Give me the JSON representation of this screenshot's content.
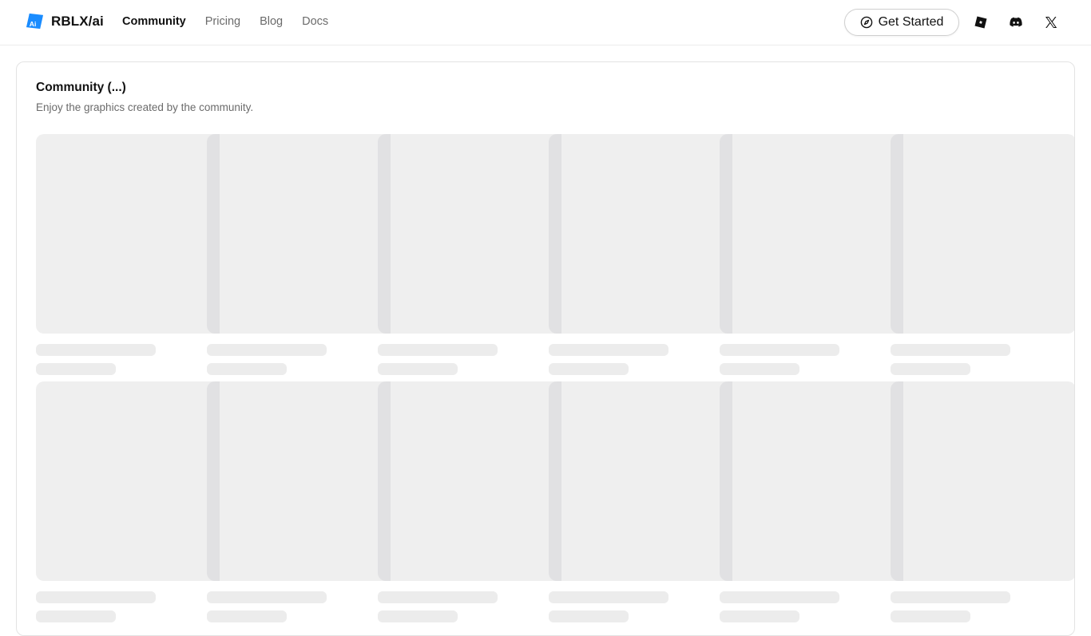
{
  "header": {
    "brand": "RBLX/ai",
    "nav": [
      {
        "label": "Community",
        "active": true
      },
      {
        "label": "Pricing",
        "active": false
      },
      {
        "label": "Blog",
        "active": false
      },
      {
        "label": "Docs",
        "active": false
      }
    ],
    "cta_label": "Get Started",
    "social_icons": [
      "roblox-icon",
      "discord-icon",
      "x-icon"
    ]
  },
  "community": {
    "title": "Community (...)",
    "subtitle": "Enjoy the graphics created by the community."
  },
  "skeleton": {
    "rows": 2,
    "cards_per_row": 6
  },
  "colors": {
    "brand_blue": "#1a8cff",
    "skeleton_fill": "#efefef",
    "skeleton_line": "#ececec"
  }
}
